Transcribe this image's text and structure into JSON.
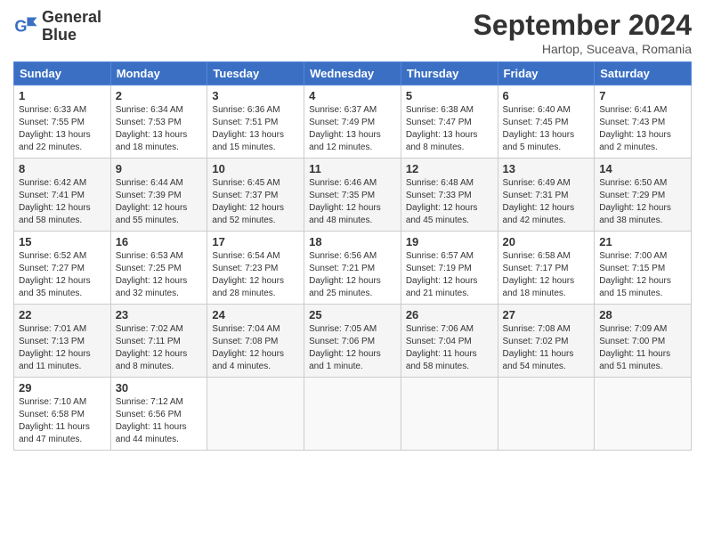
{
  "header": {
    "logo_line1": "General",
    "logo_line2": "Blue",
    "month": "September 2024",
    "location": "Hartop, Suceava, Romania"
  },
  "weekdays": [
    "Sunday",
    "Monday",
    "Tuesday",
    "Wednesday",
    "Thursday",
    "Friday",
    "Saturday"
  ],
  "weeks": [
    [
      {
        "day": "1",
        "info": "Sunrise: 6:33 AM\nSunset: 7:55 PM\nDaylight: 13 hours\nand 22 minutes."
      },
      {
        "day": "2",
        "info": "Sunrise: 6:34 AM\nSunset: 7:53 PM\nDaylight: 13 hours\nand 18 minutes."
      },
      {
        "day": "3",
        "info": "Sunrise: 6:36 AM\nSunset: 7:51 PM\nDaylight: 13 hours\nand 15 minutes."
      },
      {
        "day": "4",
        "info": "Sunrise: 6:37 AM\nSunset: 7:49 PM\nDaylight: 13 hours\nand 12 minutes."
      },
      {
        "day": "5",
        "info": "Sunrise: 6:38 AM\nSunset: 7:47 PM\nDaylight: 13 hours\nand 8 minutes."
      },
      {
        "day": "6",
        "info": "Sunrise: 6:40 AM\nSunset: 7:45 PM\nDaylight: 13 hours\nand 5 minutes."
      },
      {
        "day": "7",
        "info": "Sunrise: 6:41 AM\nSunset: 7:43 PM\nDaylight: 13 hours\nand 2 minutes."
      }
    ],
    [
      {
        "day": "8",
        "info": "Sunrise: 6:42 AM\nSunset: 7:41 PM\nDaylight: 12 hours\nand 58 minutes."
      },
      {
        "day": "9",
        "info": "Sunrise: 6:44 AM\nSunset: 7:39 PM\nDaylight: 12 hours\nand 55 minutes."
      },
      {
        "day": "10",
        "info": "Sunrise: 6:45 AM\nSunset: 7:37 PM\nDaylight: 12 hours\nand 52 minutes."
      },
      {
        "day": "11",
        "info": "Sunrise: 6:46 AM\nSunset: 7:35 PM\nDaylight: 12 hours\nand 48 minutes."
      },
      {
        "day": "12",
        "info": "Sunrise: 6:48 AM\nSunset: 7:33 PM\nDaylight: 12 hours\nand 45 minutes."
      },
      {
        "day": "13",
        "info": "Sunrise: 6:49 AM\nSunset: 7:31 PM\nDaylight: 12 hours\nand 42 minutes."
      },
      {
        "day": "14",
        "info": "Sunrise: 6:50 AM\nSunset: 7:29 PM\nDaylight: 12 hours\nand 38 minutes."
      }
    ],
    [
      {
        "day": "15",
        "info": "Sunrise: 6:52 AM\nSunset: 7:27 PM\nDaylight: 12 hours\nand 35 minutes."
      },
      {
        "day": "16",
        "info": "Sunrise: 6:53 AM\nSunset: 7:25 PM\nDaylight: 12 hours\nand 32 minutes."
      },
      {
        "day": "17",
        "info": "Sunrise: 6:54 AM\nSunset: 7:23 PM\nDaylight: 12 hours\nand 28 minutes."
      },
      {
        "day": "18",
        "info": "Sunrise: 6:56 AM\nSunset: 7:21 PM\nDaylight: 12 hours\nand 25 minutes."
      },
      {
        "day": "19",
        "info": "Sunrise: 6:57 AM\nSunset: 7:19 PM\nDaylight: 12 hours\nand 21 minutes."
      },
      {
        "day": "20",
        "info": "Sunrise: 6:58 AM\nSunset: 7:17 PM\nDaylight: 12 hours\nand 18 minutes."
      },
      {
        "day": "21",
        "info": "Sunrise: 7:00 AM\nSunset: 7:15 PM\nDaylight: 12 hours\nand 15 minutes."
      }
    ],
    [
      {
        "day": "22",
        "info": "Sunrise: 7:01 AM\nSunset: 7:13 PM\nDaylight: 12 hours\nand 11 minutes."
      },
      {
        "day": "23",
        "info": "Sunrise: 7:02 AM\nSunset: 7:11 PM\nDaylight: 12 hours\nand 8 minutes."
      },
      {
        "day": "24",
        "info": "Sunrise: 7:04 AM\nSunset: 7:08 PM\nDaylight: 12 hours\nand 4 minutes."
      },
      {
        "day": "25",
        "info": "Sunrise: 7:05 AM\nSunset: 7:06 PM\nDaylight: 12 hours\nand 1 minute."
      },
      {
        "day": "26",
        "info": "Sunrise: 7:06 AM\nSunset: 7:04 PM\nDaylight: 11 hours\nand 58 minutes."
      },
      {
        "day": "27",
        "info": "Sunrise: 7:08 AM\nSunset: 7:02 PM\nDaylight: 11 hours\nand 54 minutes."
      },
      {
        "day": "28",
        "info": "Sunrise: 7:09 AM\nSunset: 7:00 PM\nDaylight: 11 hours\nand 51 minutes."
      }
    ],
    [
      {
        "day": "29",
        "info": "Sunrise: 7:10 AM\nSunset: 6:58 PM\nDaylight: 11 hours\nand 47 minutes."
      },
      {
        "day": "30",
        "info": "Sunrise: 7:12 AM\nSunset: 6:56 PM\nDaylight: 11 hours\nand 44 minutes."
      },
      {
        "day": "",
        "info": ""
      },
      {
        "day": "",
        "info": ""
      },
      {
        "day": "",
        "info": ""
      },
      {
        "day": "",
        "info": ""
      },
      {
        "day": "",
        "info": ""
      }
    ]
  ]
}
